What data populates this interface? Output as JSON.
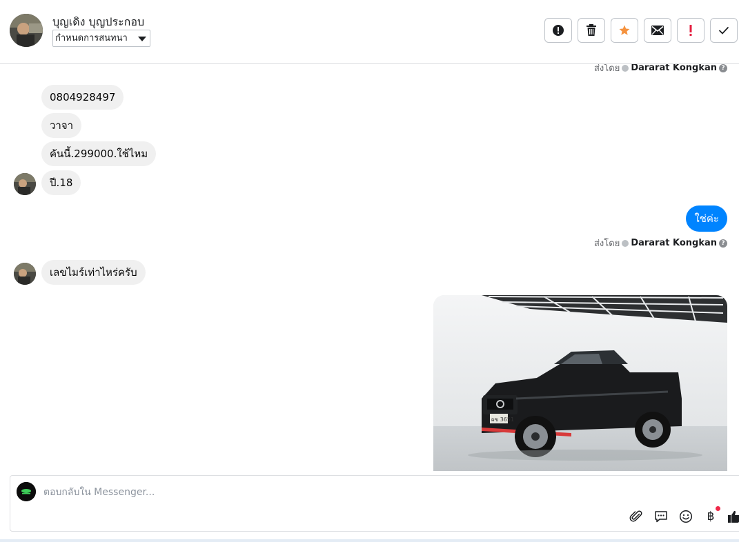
{
  "header": {
    "customer_name": "บุญเดิง บุญประกอบ",
    "conversation_select": "กำหนดการสนทนา",
    "actions": [
      {
        "icon": "exclamation-circle-icon",
        "color": "#1c1e21"
      },
      {
        "icon": "trash-icon",
        "color": "#1c1e21"
      },
      {
        "icon": "star-icon",
        "color": "#f5923e"
      },
      {
        "icon": "envelope-icon",
        "color": "#1c1e21"
      },
      {
        "icon": "exclamation-icon",
        "color": "#e41e3f"
      },
      {
        "icon": "checkmark-icon",
        "color": "#1c1e21"
      }
    ]
  },
  "thread": {
    "sent_by_label": "ส่งโดย",
    "agent_name": "Dararat Kongkan",
    "incoming_group_1": [
      "0804928497",
      "วาจา",
      "คันนี้.299000.ใช้ไหม",
      "ปี.18"
    ],
    "outgoing_reply": "ใช่ค่ะ",
    "incoming_group_2": [
      "เลขไมร์เท่าไหร่ครับ"
    ],
    "photo_plate": "ผข 3651"
  },
  "composer": {
    "placeholder": "ตอบกลับใน Messenger...",
    "tools": [
      "paperclip-icon",
      "chat-bubble-icon",
      "smiley-icon",
      "baht-icon",
      "thumbs-up-icon"
    ],
    "baht_glyph": "฿"
  },
  "colors": {
    "accent_blue": "#0084ff",
    "bubble_gray": "#f0f0f0",
    "star_orange": "#f5923e",
    "alert_red": "#e41e3f",
    "notification_red": "#f02849"
  }
}
